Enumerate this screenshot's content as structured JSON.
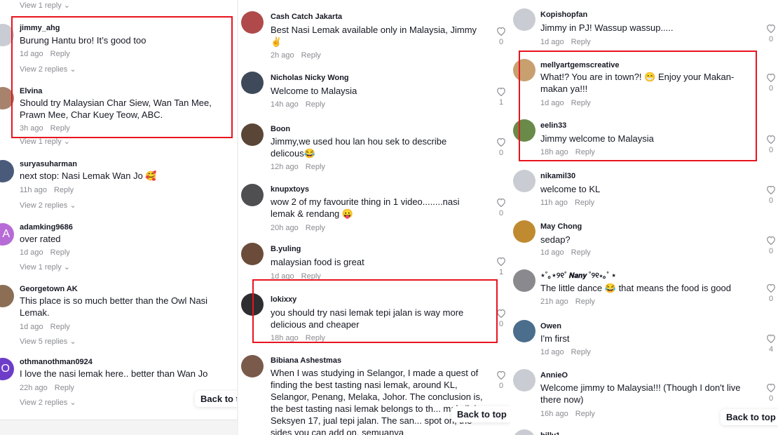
{
  "left": {
    "top_view_replies": "View 1 reply ⌄",
    "comments": [
      {
        "user": "jimmy_ahg",
        "text": "Burung Hantu bro! It’s good too",
        "time": "1d ago",
        "reply": "Reply",
        "view": "View 2 replies ⌄",
        "avatar_color": "#c9ccd2",
        "initial": ""
      },
      {
        "user": "Elvina",
        "text": "Should try Malaysian Char Siew, Wan Tan Mee, Prawn Mee, Char Kuey Teow, ABC.",
        "time": "3h ago",
        "reply": "Reply",
        "view": "View 1 reply ⌄",
        "avatar_color": "#a7826c",
        "initial": ""
      },
      {
        "user": "suryasuharman",
        "text": "next stop: Nasi Lemak Wan Jo 🥰",
        "time": "11h ago",
        "reply": "Reply",
        "view": "View 2 replies ⌄",
        "avatar_color": "#4a5a7a",
        "initial": ""
      },
      {
        "user": "adamking9686",
        "text": "over rated",
        "time": "1d ago",
        "reply": "Reply",
        "view": "View 1 reply ⌄",
        "avatar_color": "#b66bd6",
        "initial": "A"
      },
      {
        "user": "Georgetown AK",
        "text": "This place is so much better than the Owl Nasi Lemak.",
        "time": "1d ago",
        "reply": "Reply",
        "view": "View 5 replies ⌄",
        "avatar_color": "#8c6e55",
        "initial": ""
      },
      {
        "user": "othmanothman0924",
        "text": "I love the nasi lemak here.. better than Wan Jo",
        "time": "22h ago",
        "reply": "Reply",
        "view": "View 2 replies ⌄",
        "avatar_color": "#6d3cc8",
        "initial": "O"
      }
    ],
    "back_to_top": "Back to t"
  },
  "middle": {
    "comments": [
      {
        "user": "Cash Catch Jakarta",
        "text": "Best Nasi Lemak available only in Malaysia, Jimmy ✌️",
        "time": "2h ago",
        "reply": "Reply",
        "likes": "0",
        "avatar_color": "#b04a4a"
      },
      {
        "user": "Nicholas Nicky Wong",
        "text": "Welcome to Malaysia",
        "time": "14h ago",
        "reply": "Reply",
        "likes": "1",
        "avatar_color": "#3e4a5a"
      },
      {
        "user": "Boon",
        "text": "Jimmy,we used hou lan hou sek to describe delicous😂",
        "time": "12h ago",
        "reply": "Reply",
        "likes": "0",
        "avatar_color": "#5a4637"
      },
      {
        "user": "knupxtoys",
        "text": "wow 2 of my favourite thing in 1 video........nasi lemak & rendang 😛",
        "time": "20h ago",
        "reply": "Reply",
        "likes": "0",
        "avatar_color": "#4f4f52"
      },
      {
        "user": "B.yuling",
        "text": "malaysian food is great",
        "time": "1d ago",
        "reply": "Reply",
        "likes": "1",
        "avatar_color": "#6b4c3b"
      },
      {
        "user": "lokixxy",
        "text": "you should try nasi lemak tepi jalan is way more delicious and cheaper",
        "time": "18h ago",
        "reply": "Reply",
        "likes": "0",
        "avatar_color": "#2e2e30"
      },
      {
        "user": "Bibiana Ashestmas",
        "text": "When I was studying in Selangor, I made a quest of finding the best tasting nasi lemak, around KL, Selangor, Penang, Melaka, Johor. The conclusion is, the best tasting nasi lemak belongs to th... makcik in Seksyen 17, jual tepi jalan. The san... spot on, the sides you can add on, semuanya",
        "likes": "0",
        "avatar_color": "#7a5a4a"
      }
    ],
    "back_to_top": "Back to top"
  },
  "right": {
    "comments": [
      {
        "user": "Kopishopfan",
        "text": "Jimmy in PJ! Wassup wassup.....",
        "time": "1d ago",
        "reply": "Reply",
        "likes": "0",
        "avatar_color": "#c9ccd2"
      },
      {
        "user": "mellyartgemscreative",
        "text": "What!? You are in town?! 😁 Enjoy your Makan-makan ya!!!",
        "time": "1d ago",
        "reply": "Reply",
        "likes": "0",
        "avatar_color": "#c8a070"
      },
      {
        "user": "eelin33",
        "text": "Jimmy welcome to Malaysia",
        "time": "18h ago",
        "reply": "Reply",
        "likes": "0",
        "avatar_color": "#6a8a4a"
      },
      {
        "user": "nikamil30",
        "text": "welcome to KL",
        "time": "11h ago",
        "reply": "Reply",
        "likes": "0",
        "avatar_color": "#c9ccd2"
      },
      {
        "user": "May Chong",
        "text": "sedap?",
        "time": "1d ago",
        "reply": "Reply",
        "likes": "0",
        "avatar_color": "#c08a30"
      },
      {
        "user": "⋆˚｡⋆୨୧˚ 𝙉𝙖𝙣𝙮 ˚୨୧⋆｡˚ ⋆",
        "text": "The little dance 😂 that means the food is good",
        "time": "21h ago",
        "reply": "Reply",
        "likes": "0",
        "avatar_color": "#8a8a8e"
      },
      {
        "user": "Owen",
        "text": "I'm first",
        "time": "1d ago",
        "reply": "Reply",
        "likes": "4",
        "avatar_color": "#4a6e8c"
      },
      {
        "user": "AnnieO",
        "text": "Welcome jimmy to Malaysia!!! (Though I don't live there now)",
        "time": "16h ago",
        "reply": "Reply",
        "likes": "0",
        "avatar_color": "#c9ccd2"
      },
      {
        "user": "billy1",
        "avatar_color": "#c9ccd2"
      }
    ],
    "back_to_top": "Back to top"
  }
}
